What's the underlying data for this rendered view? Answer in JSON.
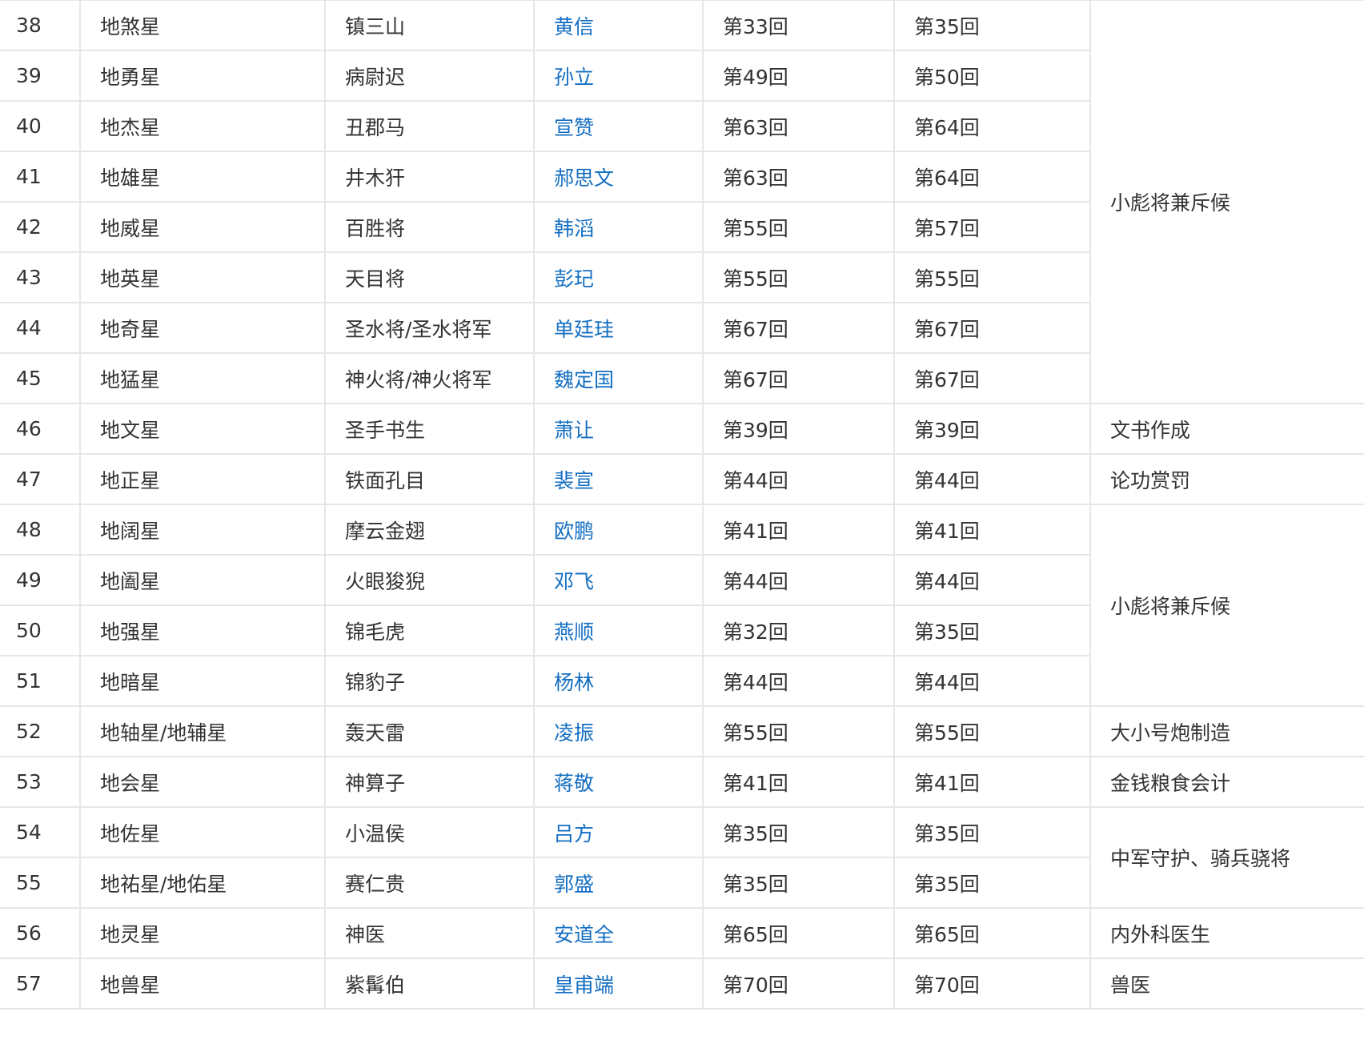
{
  "rows": [
    {
      "no": "38",
      "star": "地煞星",
      "nickname": "镇三山",
      "name": "黄信",
      "first": "第33回",
      "join": "第35回"
    },
    {
      "no": "39",
      "star": "地勇星",
      "nickname": "病尉迟",
      "name": "孙立",
      "first": "第49回",
      "join": "第50回"
    },
    {
      "no": "40",
      "star": "地杰星",
      "nickname": "丑郡马",
      "name": "宣赞",
      "first": "第63回",
      "join": "第64回"
    },
    {
      "no": "41",
      "star": "地雄星",
      "nickname": "井木犴",
      "name": "郝思文",
      "first": "第63回",
      "join": "第64回"
    },
    {
      "no": "42",
      "star": "地威星",
      "nickname": "百胜将",
      "name": "韩滔",
      "first": "第55回",
      "join": "第57回"
    },
    {
      "no": "43",
      "star": "地英星",
      "nickname": "天目将",
      "name": "彭玘",
      "first": "第55回",
      "join": "第55回"
    },
    {
      "no": "44",
      "star": "地奇星",
      "nickname": "圣水将/圣水将军",
      "name": "单廷珪",
      "first": "第67回",
      "join": "第67回"
    },
    {
      "no": "45",
      "star": "地猛星",
      "nickname": "神火将/神火将军",
      "name": "魏定国",
      "first": "第67回",
      "join": "第67回"
    },
    {
      "no": "46",
      "star": "地文星",
      "nickname": "圣手书生",
      "name": "萧让",
      "first": "第39回",
      "join": "第39回"
    },
    {
      "no": "47",
      "star": "地正星",
      "nickname": "铁面孔目",
      "name": "裴宣",
      "first": "第44回",
      "join": "第44回"
    },
    {
      "no": "48",
      "star": "地阔星",
      "nickname": "摩云金翅",
      "name": "欧鹏",
      "first": "第41回",
      "join": "第41回"
    },
    {
      "no": "49",
      "star": "地阖星",
      "nickname": "火眼狻猊",
      "name": "邓飞",
      "first": "第44回",
      "join": "第44回"
    },
    {
      "no": "50",
      "star": "地强星",
      "nickname": "锦毛虎",
      "name": "燕顺",
      "first": "第32回",
      "join": "第35回"
    },
    {
      "no": "51",
      "star": "地暗星",
      "nickname": "锦豹子",
      "name": "杨林",
      "first": "第44回",
      "join": "第44回"
    },
    {
      "no": "52",
      "star": "地轴星/地辅星",
      "nickname": "轰天雷",
      "name": "凌振",
      "first": "第55回",
      "join": "第55回"
    },
    {
      "no": "53",
      "star": "地会星",
      "nickname": "神算子",
      "name": "蒋敬",
      "first": "第41回",
      "join": "第41回"
    },
    {
      "no": "54",
      "star": "地佐星",
      "nickname": "小温侯",
      "name": "吕方",
      "first": "第35回",
      "join": "第35回"
    },
    {
      "no": "55",
      "star": "地祐星/地佑星",
      "nickname": "赛仁贵",
      "name": "郭盛",
      "first": "第35回",
      "join": "第35回"
    },
    {
      "no": "56",
      "star": "地灵星",
      "nickname": "神医",
      "name": "安道全",
      "first": "第65回",
      "join": "第65回"
    },
    {
      "no": "57",
      "star": "地兽星",
      "nickname": "紫髯伯",
      "name": "皇甫端",
      "first": "第70回",
      "join": "第70回"
    }
  ],
  "duties": [
    {
      "text": "小彪将兼斥候",
      "rows_spanned": 8
    },
    {
      "text": "文书作成",
      "rows_spanned": 1
    },
    {
      "text": "论功赏罚",
      "rows_spanned": 1
    },
    {
      "text": "小彪将兼斥候",
      "rows_spanned": 4
    },
    {
      "text": "大小号炮制造",
      "rows_spanned": 1
    },
    {
      "text": "金钱粮食会计",
      "rows_spanned": 1
    },
    {
      "text": "中军守护、骑兵骁将",
      "rows_spanned": 2
    },
    {
      "text": "内外科医生",
      "rows_spanned": 1
    },
    {
      "text": "兽医",
      "rows_spanned": 1
    }
  ],
  "colors": {
    "link": "#136ec2",
    "text": "#333333",
    "border": "#e6e6e6"
  }
}
